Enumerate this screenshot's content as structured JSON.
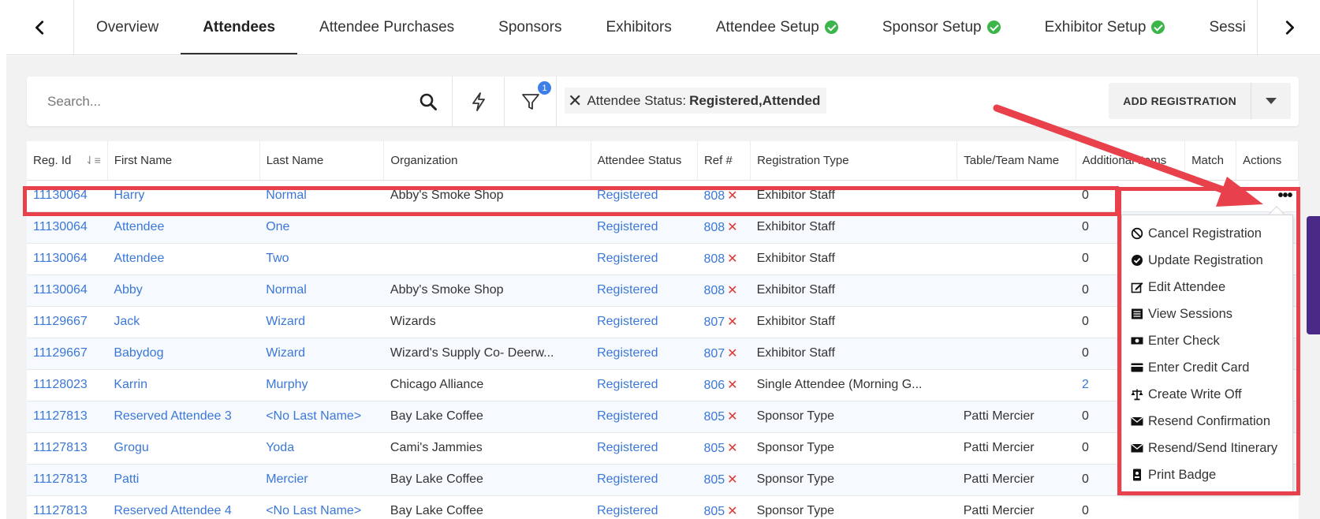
{
  "tabs": [
    {
      "label": "Overview",
      "active": false,
      "check": false
    },
    {
      "label": "Attendees",
      "active": true,
      "check": false
    },
    {
      "label": "Attendee Purchases",
      "active": false,
      "check": false
    },
    {
      "label": "Sponsors",
      "active": false,
      "check": false
    },
    {
      "label": "Exhibitors",
      "active": false,
      "check": false
    },
    {
      "label": "Attendee Setup",
      "active": false,
      "check": true
    },
    {
      "label": "Sponsor Setup",
      "active": false,
      "check": true
    },
    {
      "label": "Exhibitor Setup",
      "active": false,
      "check": true
    },
    {
      "label": "Sessi",
      "active": false,
      "check": false
    }
  ],
  "toolbar": {
    "search_placeholder": "Search...",
    "filter_count": "1",
    "filter_chip_label": "Attendee Status:",
    "filter_chip_value": "Registered,Attended",
    "add_registration_label": "ADD REGISTRATION"
  },
  "table": {
    "columns": [
      "Reg. Id",
      "First Name",
      "Last Name",
      "Organization",
      "Attendee Status",
      "Ref #",
      "Registration Type",
      "Table/Team Name",
      "Additional Items",
      "Match",
      "Actions"
    ],
    "rows": [
      {
        "reg_id": "11130064",
        "first": "Harry",
        "last": "Normal",
        "org": "Abby's Smoke Shop",
        "status": "Registered",
        "ref": "808",
        "type": "Exhibitor Staff",
        "team": "",
        "items": "0",
        "items_link": false
      },
      {
        "reg_id": "11130064",
        "first": "Attendee",
        "last": "One",
        "org": "",
        "status": "Registered",
        "ref": "808",
        "type": "Exhibitor Staff",
        "team": "",
        "items": "0",
        "items_link": false
      },
      {
        "reg_id": "11130064",
        "first": "Attendee",
        "last": "Two",
        "org": "",
        "status": "Registered",
        "ref": "808",
        "type": "Exhibitor Staff",
        "team": "",
        "items": "0",
        "items_link": false
      },
      {
        "reg_id": "11130064",
        "first": "Abby",
        "last": "Normal",
        "org": "Abby's Smoke Shop",
        "status": "Registered",
        "ref": "808",
        "type": "Exhibitor Staff",
        "team": "",
        "items": "0",
        "items_link": false
      },
      {
        "reg_id": "11129667",
        "first": "Jack",
        "last": "Wizard",
        "org": "Wizards",
        "status": "Registered",
        "ref": "807",
        "type": "Exhibitor Staff",
        "team": "",
        "items": "0",
        "items_link": false
      },
      {
        "reg_id": "11129667",
        "first": "Babydog",
        "last": "Wizard",
        "org": "Wizard's Supply Co- Deerw...",
        "status": "Registered",
        "ref": "807",
        "type": "Exhibitor Staff",
        "team": "",
        "items": "0",
        "items_link": false
      },
      {
        "reg_id": "11128023",
        "first": "Karrin",
        "last": "Murphy",
        "org": "Chicago Alliance",
        "status": "Registered",
        "ref": "806",
        "type": "Single Attendee (Morning G...",
        "team": "",
        "items": "2",
        "items_link": true
      },
      {
        "reg_id": "11127813",
        "first": "Reserved Attendee 3",
        "last": "<No Last Name>",
        "org": "Bay Lake Coffee",
        "status": "Registered",
        "ref": "805",
        "type": "Sponsor Type",
        "team": "Patti Mercier",
        "items": "0",
        "items_link": false
      },
      {
        "reg_id": "11127813",
        "first": "Grogu",
        "last": "Yoda",
        "org": "Cami's Jammies",
        "status": "Registered",
        "ref": "805",
        "type": "Sponsor Type",
        "team": "Patti Mercier",
        "items": "0",
        "items_link": false
      },
      {
        "reg_id": "11127813",
        "first": "Patti",
        "last": "Mercier",
        "org": "Bay Lake Coffee",
        "status": "Registered",
        "ref": "805",
        "type": "Sponsor Type",
        "team": "Patti Mercier",
        "items": "0",
        "items_link": false
      },
      {
        "reg_id": "11127813",
        "first": "Reserved Attendee 4",
        "last": "<No Last Name>",
        "org": "Bay Lake Coffee",
        "status": "Registered",
        "ref": "805",
        "type": "Sponsor Type",
        "team": "Patti Mercier",
        "items": "0",
        "items_link": false
      }
    ]
  },
  "actions_menu": [
    {
      "label": "Cancel Registration",
      "icon": "ban-icon"
    },
    {
      "label": "Update Registration",
      "icon": "check-circle-icon"
    },
    {
      "label": "Edit Attendee",
      "icon": "edit-icon"
    },
    {
      "label": "View Sessions",
      "icon": "list-icon"
    },
    {
      "label": "Enter Check",
      "icon": "money-icon"
    },
    {
      "label": "Enter Credit Card",
      "icon": "credit-card-icon"
    },
    {
      "label": "Create Write Off",
      "icon": "balance-scale-icon"
    },
    {
      "label": "Resend Confirmation",
      "icon": "envelope-icon"
    },
    {
      "label": "Resend/Send Itinerary",
      "icon": "envelope-icon"
    },
    {
      "label": "Print Badge",
      "icon": "id-badge-icon"
    }
  ],
  "colors": {
    "link": "#3b78d6",
    "highlight": "#e8414b",
    "check": "#3cb54a",
    "badge": "#3d7fe6"
  }
}
